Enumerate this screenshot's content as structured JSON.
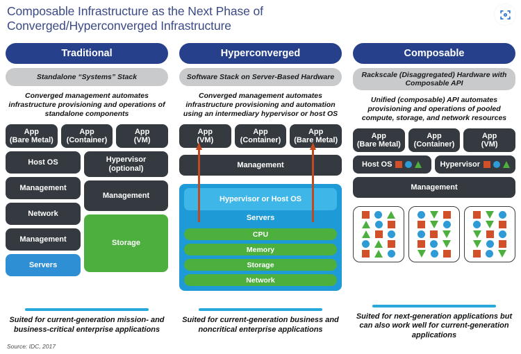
{
  "title": "Composable Infrastructure as the Next Phase of Converged/Hyperconverged Infrastructure",
  "scan_icon": "scan-focus-icon",
  "source": "Source: IDC, 2017",
  "colors": {
    "header_navy": "#26408b",
    "subheader_gray": "#c8cacc",
    "block_dark": "#343a40",
    "green": "#4caf3e",
    "blue_servers": "#2e8fd4",
    "blue_container": "#1e9bd7",
    "blue_hypervisor": "#3fb6e8",
    "arrow_orange": "#c1481f",
    "rule_cyan": "#29a8dc",
    "shape_square_orange": "#d1502a",
    "shape_circle_blue": "#2e9bd6",
    "shape_triangle_green": "#4caf3e"
  },
  "columns": [
    {
      "header": "Traditional",
      "subheader": "Standalone “Systems” Stack",
      "description": "Converged management automates infrastructure provisioning and operations of standalone components",
      "apps": [
        "App\n(Bare Metal)",
        "App\n(Container)",
        "App\n(VM)"
      ],
      "left_stack": [
        "Host OS",
        "Management",
        "Network",
        "Management",
        "Servers"
      ],
      "right_stack": [
        "Hypervisor\n(optional)",
        "Management",
        "Storage"
      ],
      "footer": "Suited for current-generation mission- and business-critical enterprise applications"
    },
    {
      "header": "Hyperconverged",
      "subheader": "Software Stack on Server-Based Hardware",
      "description": "Converged management automates infrastructure provisioning and automation using an intermediary hypervisor or host OS",
      "apps": [
        "App\n(VM)",
        "App\n(Container)",
        "App\n(Bare Metal)"
      ],
      "management": "Management",
      "hypervisor_band": "Hypervisor or Host OS",
      "servers_label": "Servers",
      "resources": [
        "CPU",
        "Memory",
        "Storage",
        "Network"
      ],
      "footer": "Suited for current-generation business and noncritical enterprise applications"
    },
    {
      "header": "Composable",
      "subheader": "Rackscale (Disaggregated) Hardware with Composable API",
      "description": "Unified (composable) API automates provisioning and operations of pooled compute, storage, and network resources",
      "apps": [
        "App\n(Bare Metal)",
        "App\n(Container)",
        "App\n(VM)"
      ],
      "os_row": [
        "Host OS",
        "Hypervisor"
      ],
      "management": "Management",
      "pools": [
        [
          [
            "square",
            "circle",
            "triangle-up"
          ],
          [
            "triangle-up",
            "circle",
            "square"
          ],
          [
            "triangle-up",
            "square",
            "circle"
          ],
          [
            "circle",
            "triangle-up",
            "square"
          ],
          [
            "square",
            "triangle-up",
            "circle"
          ]
        ],
        [
          [
            "circle",
            "triangle-down",
            "square"
          ],
          [
            "square",
            "triangle-down",
            "circle"
          ],
          [
            "circle",
            "square",
            "triangle-down"
          ],
          [
            "square",
            "circle",
            "triangle-down"
          ],
          [
            "triangle-down",
            "circle",
            "square"
          ]
        ],
        [
          [
            "square",
            "triangle-down",
            "circle"
          ],
          [
            "circle",
            "triangle-down",
            "square"
          ],
          [
            "triangle-down",
            "square",
            "circle"
          ],
          [
            "triangle-down",
            "circle",
            "square"
          ],
          [
            "square",
            "circle",
            "triangle-down"
          ]
        ]
      ],
      "footer": "Suited for next-generation applications but can also work well for current-generation applications"
    }
  ]
}
